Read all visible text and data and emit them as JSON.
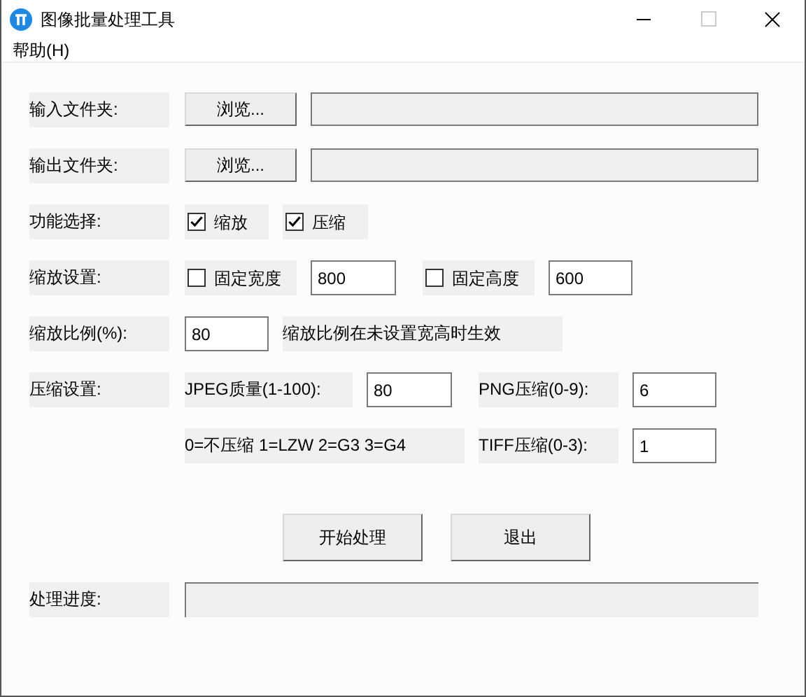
{
  "window": {
    "title": "图像批量处理工具"
  },
  "menu": [
    "帮助(H)"
  ],
  "input_folder": {
    "label": "输入文件夹:",
    "button": "浏览..."
  },
  "output_folder": {
    "label": "输出文件夹:",
    "button": "浏览..."
  },
  "function": {
    "label": "功能选择:",
    "options": [
      {
        "label": "缩放",
        "checked": true
      },
      {
        "label": "压缩",
        "checked": true
      }
    ]
  },
  "resize": {
    "label": "缩放设置:",
    "width": {
      "label": "固定宽度",
      "checked": false,
      "value": "800"
    },
    "height": {
      "label": "固定高度",
      "checked": false,
      "value": "600"
    }
  },
  "scale": {
    "label": "缩放比例(%):",
    "value": "80",
    "note": "缩放比例在未设置宽高时生效"
  },
  "compression": {
    "label": "压缩设置:",
    "jpeg": {
      "label": "JPEG质量(1-100):",
      "value": "80"
    },
    "png": {
      "label": "PNG压缩(0-9):",
      "value": "6"
    },
    "tiff_note": "0=不压缩 1=LZW 2=G3 3=G4",
    "tiff": {
      "label": "TIFF压缩(0-3):",
      "value": "1"
    }
  },
  "buttons": [
    "开始处理",
    "退出"
  ],
  "progress": {
    "label": "处理进度:",
    "level": 0
  }
}
